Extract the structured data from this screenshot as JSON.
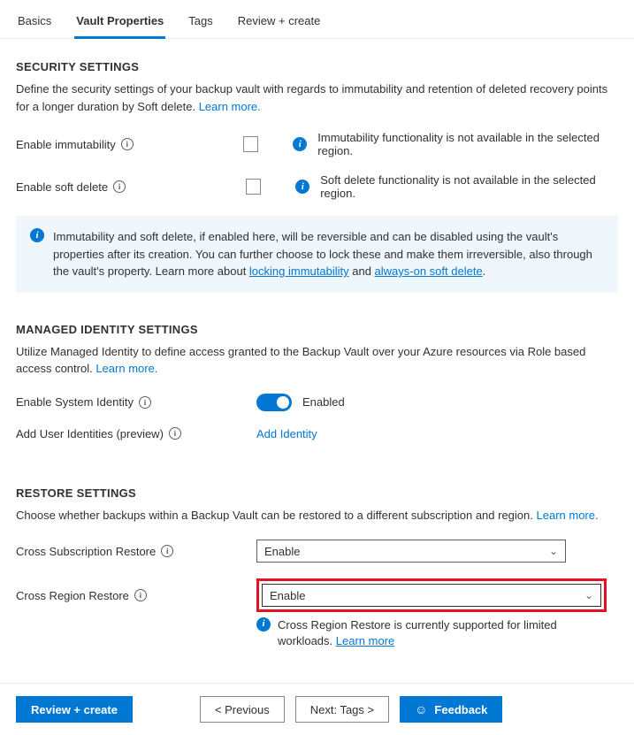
{
  "tabs": {
    "basics": "Basics",
    "vault": "Vault Properties",
    "tags": "Tags",
    "review": "Review + create"
  },
  "security": {
    "title": "SECURITY SETTINGS",
    "desc": "Define the security settings of your backup vault with regards to immutability and retention of deleted recovery points for a longer duration by Soft delete. ",
    "learn_more": "Learn more.",
    "enable_immutability_label": "Enable immutability",
    "immutability_msg": "Immutability functionality is not available in the selected region.",
    "enable_soft_delete_label": "Enable soft delete",
    "soft_delete_msg": "Soft delete functionality is not available in the selected region.",
    "banner_p1": "Immutability and soft delete, if enabled here, will be reversible and can be disabled using the vault's properties after its creation. You can further choose to lock these and make them irreversible, also through the vault's property. Learn more about ",
    "banner_link1": "locking immutability",
    "banner_mid": " and ",
    "banner_link2": "always-on soft delete",
    "banner_end": "."
  },
  "identity": {
    "title": "MANAGED IDENTITY SETTINGS",
    "desc": "Utilize Managed Identity to define access granted to the Backup Vault over your Azure resources via Role based access control. ",
    "learn_more": "Learn more.",
    "enable_system_label": "Enable System Identity",
    "enabled_text": "Enabled",
    "add_user_label": "Add User Identities (preview)",
    "add_identity_link": "Add Identity"
  },
  "restore": {
    "title": "RESTORE SETTINGS",
    "desc": "Choose whether backups within a Backup Vault can be restored to a different subscription and region. ",
    "learn_more": "Learn more.",
    "cross_sub_label": "Cross Subscription Restore",
    "cross_sub_value": "Enable",
    "cross_region_label": "Cross Region Restore",
    "cross_region_value": "Enable",
    "crr_info": "Cross Region Restore is currently supported for limited workloads. ",
    "crr_learn": "Learn more"
  },
  "footer": {
    "review": "Review + create",
    "previous": "< Previous",
    "next": "Next: Tags >",
    "feedback": "Feedback"
  }
}
